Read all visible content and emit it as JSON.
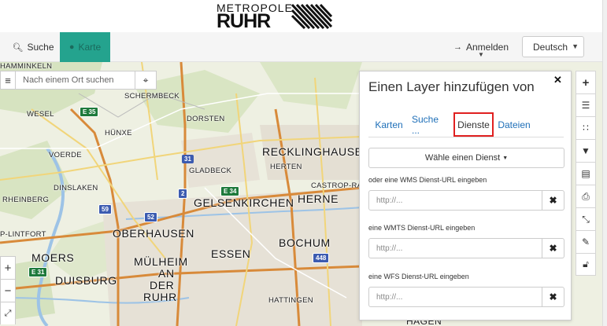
{
  "logo": {
    "top": "METROPOLE",
    "bottom": "RUHR"
  },
  "navbar": {
    "search_label": "Suche",
    "karte_label": "Karte",
    "login_label": "Anmelden",
    "language": "Deutsch"
  },
  "map": {
    "search_placeholder": "Nach einem Ort suchen",
    "places": [
      "HAMMINKELN",
      "SCHERMBECK",
      "WESEL",
      "DORSTEN",
      "HÜNXE",
      "VOERDE",
      "RECKLINGHAUSEN",
      "HERTEN",
      "GLADBECK",
      "DINSLAKEN",
      "CASTROP-RA",
      "RHEINBERG",
      "GELSENKIRCHEN",
      "HERNE",
      "P-LINTFORT",
      "OBERHAUSEN",
      "BOCHUM",
      "ESSEN",
      "MOERS",
      "DUISBURG",
      "MÜLHEIM",
      "AN",
      "DER",
      "RUHR",
      "HATTINGEN",
      "HAGEN"
    ],
    "road_shields": [
      "E 35",
      "31",
      "E 34",
      "2",
      "59",
      "52",
      "448",
      "E 31"
    ]
  },
  "zoom": {
    "in": "+",
    "out": "−"
  },
  "panel": {
    "title": "Einen Layer hinzufügen von",
    "tabs": [
      "Karten",
      "Suche ...",
      "Dienste",
      "Dateien"
    ],
    "active_tab": "Dienste",
    "choose_label": "Wähle einen Dienst",
    "wms_label": "oder  eine WMS Dienst-URL eingeben",
    "wmts_label": "eine WMTS Dienst-URL eingeben",
    "wfs_label": "eine WFS Dienst-URL eingeben",
    "url_placeholder": "http://..."
  },
  "colors": {
    "accent": "#24a38e",
    "highlight": "#e02020",
    "link": "#1e6fb8"
  },
  "icons": [
    "search-icon",
    "globe-icon",
    "login-icon",
    "menu-icon",
    "locate-icon",
    "plus-icon",
    "layers-icon",
    "list-icon",
    "filter-icon",
    "map-icon",
    "print-icon",
    "expand-icon",
    "pencil-icon",
    "lock-icon",
    "close-icon"
  ]
}
